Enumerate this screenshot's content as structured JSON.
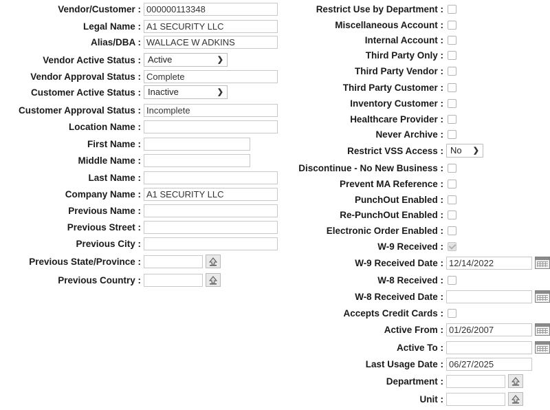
{
  "left": {
    "vendor_customer": {
      "label": "Vendor/Customer :",
      "value": "000000113348"
    },
    "legal_name": {
      "label": "Legal Name :",
      "value": "A1 SECURITY LLC"
    },
    "alias_dba": {
      "label": "Alias/DBA :",
      "value": "WALLACE W ADKINS"
    },
    "vendor_active_status": {
      "label": "Vendor Active Status :",
      "value": "Active"
    },
    "vendor_approval_status": {
      "label": "Vendor Approval Status :",
      "value": "Complete"
    },
    "customer_active_status": {
      "label": "Customer Active Status :",
      "value": "Inactive"
    },
    "customer_approval_status": {
      "label": "Customer Approval Status :",
      "value": "Incomplete"
    },
    "location_name": {
      "label": "Location Name :",
      "value": ""
    },
    "first_name": {
      "label": "First Name :",
      "value": ""
    },
    "middle_name": {
      "label": "Middle Name :",
      "value": ""
    },
    "last_name": {
      "label": "Last Name :",
      "value": ""
    },
    "company_name": {
      "label": "Company Name :",
      "value": "A1 SECURITY LLC"
    },
    "previous_name": {
      "label": "Previous Name :",
      "value": ""
    },
    "previous_street": {
      "label": "Previous Street :",
      "value": ""
    },
    "previous_city": {
      "label": "Previous City :",
      "value": ""
    },
    "previous_state": {
      "label": "Previous State/Province :",
      "value": ""
    },
    "previous_country": {
      "label": "Previous Country :",
      "value": ""
    }
  },
  "right": {
    "restrict_use_by_department": {
      "label": "Restrict Use by Department :",
      "checked": false
    },
    "miscellaneous_account": {
      "label": "Miscellaneous Account :",
      "checked": false
    },
    "internal_account": {
      "label": "Internal Account :",
      "checked": false
    },
    "third_party_only": {
      "label": "Third Party Only :",
      "checked": false
    },
    "third_party_vendor": {
      "label": "Third Party Vendor :",
      "checked": false
    },
    "third_party_customer": {
      "label": "Third Party Customer :",
      "checked": false
    },
    "inventory_customer": {
      "label": "Inventory Customer :",
      "checked": false
    },
    "healthcare_provider": {
      "label": "Healthcare Provider :",
      "checked": false
    },
    "never_archive": {
      "label": "Never Archive :",
      "checked": false
    },
    "restrict_vss_access": {
      "label": "Restrict VSS Access :",
      "value": "No"
    },
    "discontinue_no_new_business": {
      "label": "Discontinue - No New Business :",
      "checked": false
    },
    "prevent_ma_reference": {
      "label": "Prevent MA Reference :",
      "checked": false
    },
    "punchout_enabled": {
      "label": "PunchOut Enabled :",
      "checked": false
    },
    "re_punchout_enabled": {
      "label": "Re-PunchOut Enabled :",
      "checked": false
    },
    "electronic_order_enabled": {
      "label": "Electronic Order Enabled :",
      "checked": false
    },
    "w9_received": {
      "label": "W-9 Received :",
      "checked": true
    },
    "w9_received_date": {
      "label": "W-9 Received Date :",
      "value": "12/14/2022"
    },
    "w8_received": {
      "label": "W-8 Received :",
      "checked": false
    },
    "w8_received_date": {
      "label": "W-8 Received Date :",
      "value": ""
    },
    "accepts_credit_cards": {
      "label": "Accepts Credit Cards :",
      "checked": false
    },
    "active_from": {
      "label": "Active From :",
      "value": "01/26/2007"
    },
    "active_to": {
      "label": "Active To :",
      "value": ""
    },
    "last_usage_date": {
      "label": "Last Usage Date :",
      "value": "06/27/2025"
    },
    "department": {
      "label": "Department :",
      "value": ""
    },
    "unit": {
      "label": "Unit :",
      "value": ""
    }
  },
  "icons": {
    "lookup": "lookup-arrow-icon",
    "calendar": "calendar-icon",
    "dropdown": "chevron-down-icon"
  }
}
